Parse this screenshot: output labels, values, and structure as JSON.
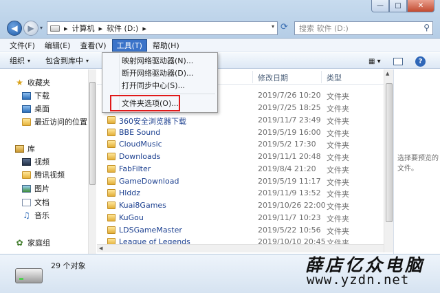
{
  "window": {
    "minimize_label": "—",
    "maximize_label": "□",
    "close_label": "✕"
  },
  "nav": {
    "back_glyph": "◀",
    "forward_glyph": "▶",
    "dropdown_glyph": "▾"
  },
  "address": {
    "sep1": "▸",
    "part1": "计算机",
    "sep2": "▸",
    "part2": "软件 (D:)",
    "sep3": "▸",
    "dropdown": "▾",
    "refresh": "⟳"
  },
  "search": {
    "placeholder": "搜索 软件 (D:)",
    "icon": "search-icon"
  },
  "menubar": {
    "items": [
      "文件(F)",
      "编辑(E)",
      "查看(V)",
      "工具(T)",
      "帮助(H)"
    ],
    "active": "工具(T)"
  },
  "toolbar": {
    "organize": "组织",
    "include": "包含到库中",
    "caret": "▾",
    "view_glyph": "▦ ▾",
    "help_glyph": "?"
  },
  "dropdown_menu": {
    "items": [
      "映射网络驱动器(N)...",
      "断开网络驱动器(D)...",
      "打开同步中心(S)...",
      "文件夹选项(O)..."
    ],
    "highlighted": "文件夹选项(O)...",
    "highlight_color": "#e01919"
  },
  "navpane": {
    "favorites": {
      "label": "收藏夹",
      "items": [
        "下载",
        "桌面",
        "最近访问的位置"
      ]
    },
    "libraries": {
      "label": "库",
      "items": [
        "视频",
        "腾讯视频",
        "图片",
        "文档",
        "音乐"
      ]
    },
    "homegroup": {
      "label": "家庭组"
    }
  },
  "columns": {
    "date": "修改日期",
    "type": "类型"
  },
  "files": [
    {
      "name": "",
      "date": "2019/7/26 10:20",
      "type": "文件夹"
    },
    {
      "name": "",
      "date": "2019/7/25 18:25",
      "type": "文件夹"
    },
    {
      "name": "360安全浏览器下载",
      "date": "2019/11/7 23:49",
      "type": "文件夹"
    },
    {
      "name": "BBE Sound",
      "date": "2019/5/19 16:00",
      "type": "文件夹"
    },
    {
      "name": "CloudMusic",
      "date": "2019/5/2 17:30",
      "type": "文件夹"
    },
    {
      "name": "Downloads",
      "date": "2019/11/1 20:48",
      "type": "文件夹"
    },
    {
      "name": "FabFilter",
      "date": "2019/8/4 21:20",
      "type": "文件夹"
    },
    {
      "name": "GameDownload",
      "date": "2019/5/19 11:17",
      "type": "文件夹"
    },
    {
      "name": "Hlddz",
      "date": "2019/11/9 13:52",
      "type": "文件夹"
    },
    {
      "name": "Kuai8Games",
      "date": "2019/10/26 22:00",
      "type": "文件夹"
    },
    {
      "name": "KuGou",
      "date": "2019/11/7 10:23",
      "type": "文件夹"
    },
    {
      "name": "LDSGameMaster",
      "date": "2019/5/22 10:56",
      "type": "文件夹"
    },
    {
      "name": "League of Legends",
      "date": "2019/10/10 20:45",
      "type": "文件夹"
    }
  ],
  "preview": {
    "text": "选择要预览的文件。"
  },
  "status": {
    "count": "29 个对象"
  },
  "watermark": {
    "name": "薛店亿众电脑",
    "url": "www.yzdn.net"
  },
  "colors": {
    "menu_active": "#3a73c9",
    "link_text": "#1b3f8f"
  }
}
